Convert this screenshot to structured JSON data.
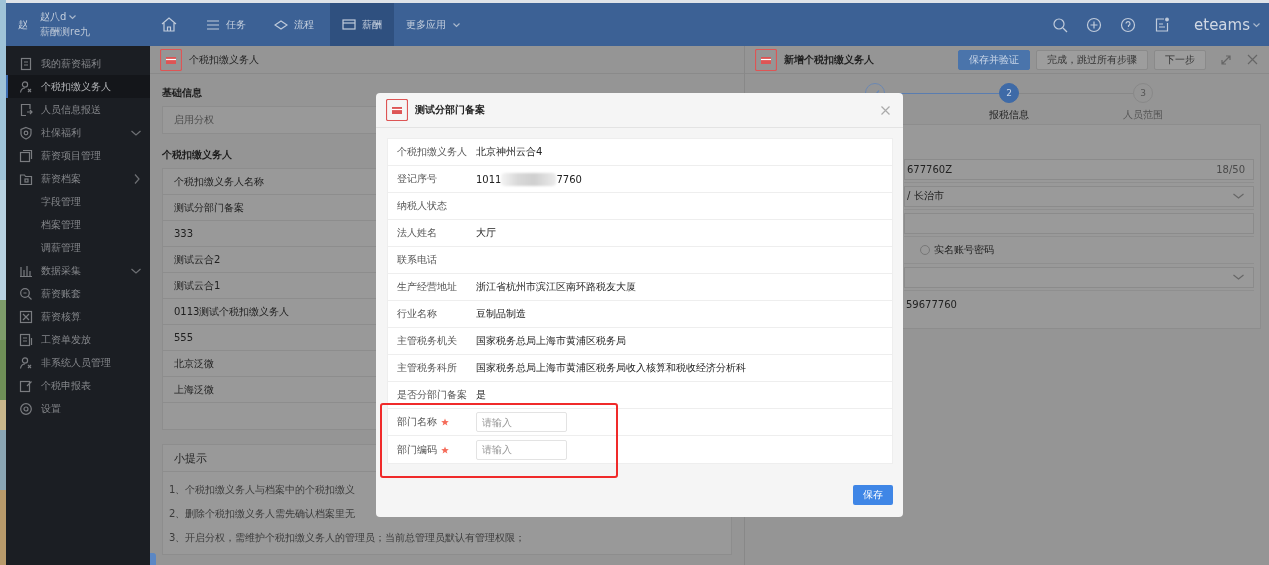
{
  "topbar": {
    "avatar": "赵",
    "user_name": "赵八d",
    "user_subtitle": "薪酬测re九",
    "brand": "eteams",
    "nav": [
      {
        "kind": "home",
        "selected": false
      },
      {
        "kind": "tasks",
        "label": "任务",
        "selected": false
      },
      {
        "kind": "flow",
        "label": "流程",
        "selected": false
      },
      {
        "kind": "salary",
        "label": "薪酬",
        "selected": true
      },
      {
        "kind": "more",
        "label": "更多应用",
        "selected": false
      }
    ]
  },
  "sidebar": {
    "items": [
      {
        "label": "我的薪资福利",
        "selected": false
      },
      {
        "label": "个税扣缴义务人",
        "selected": true
      },
      {
        "label": "人员信息报送",
        "selected": false
      },
      {
        "label": "社保福利",
        "kind": "group",
        "expanded": false,
        "selected": false
      },
      {
        "label": "薪资项目管理",
        "selected": false
      },
      {
        "label": "薪资档案",
        "kind": "group",
        "expanded": true,
        "selected": false,
        "children": [
          {
            "label": "字段管理",
            "selected": false
          },
          {
            "label": "档案管理",
            "selected": false
          },
          {
            "label": "调薪管理",
            "selected": false
          }
        ]
      },
      {
        "label": "数据采集",
        "kind": "group",
        "expanded": false,
        "selected": false
      },
      {
        "label": "薪资账套",
        "selected": false
      },
      {
        "label": "薪资核算",
        "selected": false
      },
      {
        "label": "工资单发放",
        "selected": false
      },
      {
        "label": "非系统人员管理",
        "selected": false
      },
      {
        "label": "个税申报表",
        "selected": false
      },
      {
        "label": "设置",
        "selected": false
      }
    ]
  },
  "left_panel": {
    "title": "个税扣缴义务人",
    "basic_heading": "基础信息",
    "basic_rows": [
      "启用分权"
    ],
    "list_heading": "个税扣缴义务人",
    "list_header": "个税扣缴义务人名称",
    "list_rows": [
      "测试分部门备案",
      "333",
      "测试云合2",
      "测试云合1",
      "0113测试个税扣缴义务人",
      "555",
      "北京泛微",
      "上海泛微"
    ],
    "tips": {
      "title": "小提示",
      "lines": [
        "1、个税扣缴义务人与档案中的个税扣缴义",
        "2、删除个税扣缴义务人需先确认档案里无",
        "3、开启分权，需维护个税扣缴义务人的管理员；当前总管理员默认有管理权限；"
      ]
    }
  },
  "right_panel": {
    "title": "新增个税扣缴义务人",
    "buttons": [
      {
        "label": "保存并验证",
        "kind": "primary"
      },
      {
        "label": "完成，跳过所有步骤",
        "kind": "default"
      },
      {
        "label": "下一步",
        "kind": "default"
      }
    ],
    "steps": [
      {
        "done": true,
        "selected": false
      },
      {
        "number": "2",
        "label": "报税信息",
        "done": false,
        "selected": true
      },
      {
        "number": "3",
        "label": "人员范围",
        "done": false,
        "selected": false
      }
    ],
    "fields": [
      {
        "kind": "input",
        "value": "677760Z",
        "counter": "18/50"
      },
      {
        "kind": "select",
        "value": "/ 长治市"
      },
      {
        "kind": "input"
      },
      {
        "kind": "radio",
        "label": "实名账号密码",
        "selected": false
      },
      {
        "kind": "select"
      },
      {
        "kind": "text",
        "value": "59677760"
      }
    ]
  },
  "modal": {
    "title": "测试分部门备案",
    "rows": [
      {
        "label": "个税扣缴义务人",
        "value": "北京神州云合4"
      },
      {
        "label": "登记序号",
        "kind": "redacted",
        "value_start": "1011",
        "value_end": "7760"
      },
      {
        "label": "纳税人状态"
      },
      {
        "label": "法人姓名",
        "value": "大厅"
      },
      {
        "label": "联系电话"
      },
      {
        "label": "生产经营地址",
        "value": "浙江省杭州市滨江区南环路税友大厦"
      },
      {
        "label": "行业名称",
        "value": "豆制品制造"
      },
      {
        "label": "主管税务机关",
        "value": "国家税务总局上海市黄浦区税务局"
      },
      {
        "label": "主管税务科所",
        "value": "国家税务总局上海市黄浦区税务局收入核算和税收经济分析科"
      },
      {
        "label": "是否分部门备案",
        "value": "是"
      }
    ],
    "inputs": [
      {
        "label": "部门名称",
        "required": true,
        "placeholder": "请输入"
      },
      {
        "label": "部门编码",
        "required": true,
        "placeholder": "请输入"
      }
    ],
    "save_button": "保存"
  }
}
